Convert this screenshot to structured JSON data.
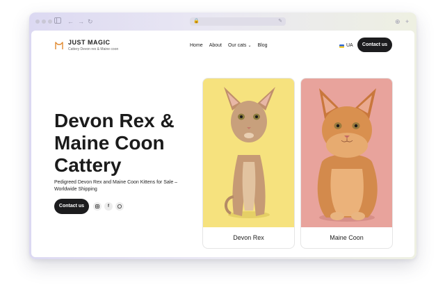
{
  "brand": {
    "title": "JUST MAGIC",
    "subtitle": "Cattery Devon rex & Maine coon"
  },
  "nav": {
    "items": [
      {
        "label": "Home"
      },
      {
        "label": "About"
      },
      {
        "label": "Our cats",
        "has_dropdown": true
      },
      {
        "label": "Blog"
      }
    ],
    "language": "UA",
    "contact_label": "Contact us"
  },
  "hero": {
    "title": "Devon Rex & Maine Coon Cattery",
    "subtitle": "Pedigreed Devon Rex and Maine Coon Kittens for Sale – Worldwide Shipping",
    "contact_label": "Contact us",
    "socials": [
      "instagram-icon",
      "facebook-icon",
      "whatsapp-icon"
    ]
  },
  "cards": [
    {
      "label": "Devon Rex",
      "bg": "#f6e27e"
    },
    {
      "label": "Maine Coon",
      "bg": "#e8a39c"
    }
  ],
  "colors": {
    "accent_dark": "#1c1c1e",
    "logo_orange": "#e0892f"
  }
}
